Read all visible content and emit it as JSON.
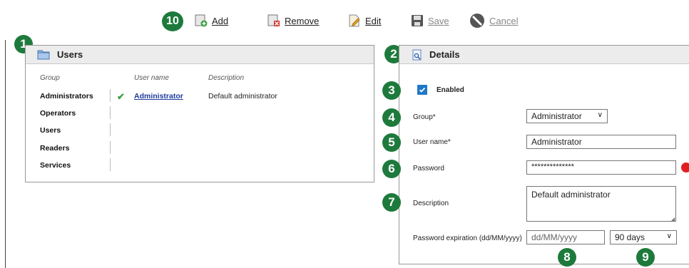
{
  "toolbar": {
    "callout": "10",
    "add": "Add",
    "remove": "Remove",
    "edit": "Edit",
    "save": "Save",
    "cancel": "Cancel"
  },
  "users_panel": {
    "callout": "1",
    "title": "Users",
    "columns": {
      "group": "Group",
      "user_name": "User name",
      "description": "Description"
    },
    "groups": [
      "Administrators",
      "Operators",
      "Users",
      "Readers",
      "Services"
    ],
    "users": [
      {
        "name": "Administrator",
        "description": "Default administrator",
        "status_icon": "check-icon"
      }
    ]
  },
  "details": {
    "callout": "2",
    "title": "Details",
    "enabled": {
      "callout": "3",
      "label": "Enabled",
      "checked": true
    },
    "group": {
      "callout": "4",
      "label": "Group*",
      "value": "Administrator"
    },
    "user_name": {
      "callout": "5",
      "label": "User name*",
      "value": "Administrator"
    },
    "password": {
      "callout": "6",
      "label": "Password",
      "value": "**************"
    },
    "description": {
      "callout": "7",
      "label": "Description",
      "value": "Default administrator"
    },
    "expiration": {
      "label": "Password expiration (dd/MM/yyyy)",
      "date_placeholder": "dd/MM/yyyy",
      "date_callout": "8",
      "duration": "90 days",
      "duration_callout": "9"
    }
  },
  "colors": {
    "badge": "#1e7a3c",
    "link": "#1f3b9c",
    "check": "#3aa040",
    "checkbox": "#1e78c8",
    "indicator": "#e02020"
  }
}
